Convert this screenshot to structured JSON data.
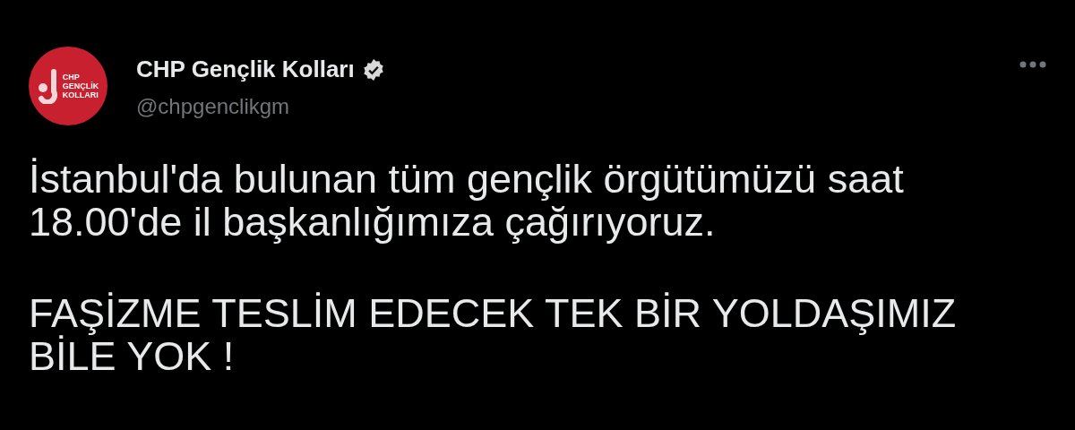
{
  "author": {
    "name": "CHP Gençlik Kolları",
    "verified": true,
    "handle": "@chpgenclikgm",
    "avatar_text": [
      "CHP",
      "GENÇLİK",
      "KOLLARI"
    ]
  },
  "paragraphs": [
    "İstanbul'da bulunan tüm gençlik örgütümüzü saat 18.00'de il başkanlığımıza çağırıyoruz.",
    "FAŞİZME TESLİM EDECEK TEK BİR YOLDAŞIMIZ BİLE YOK !"
  ]
}
